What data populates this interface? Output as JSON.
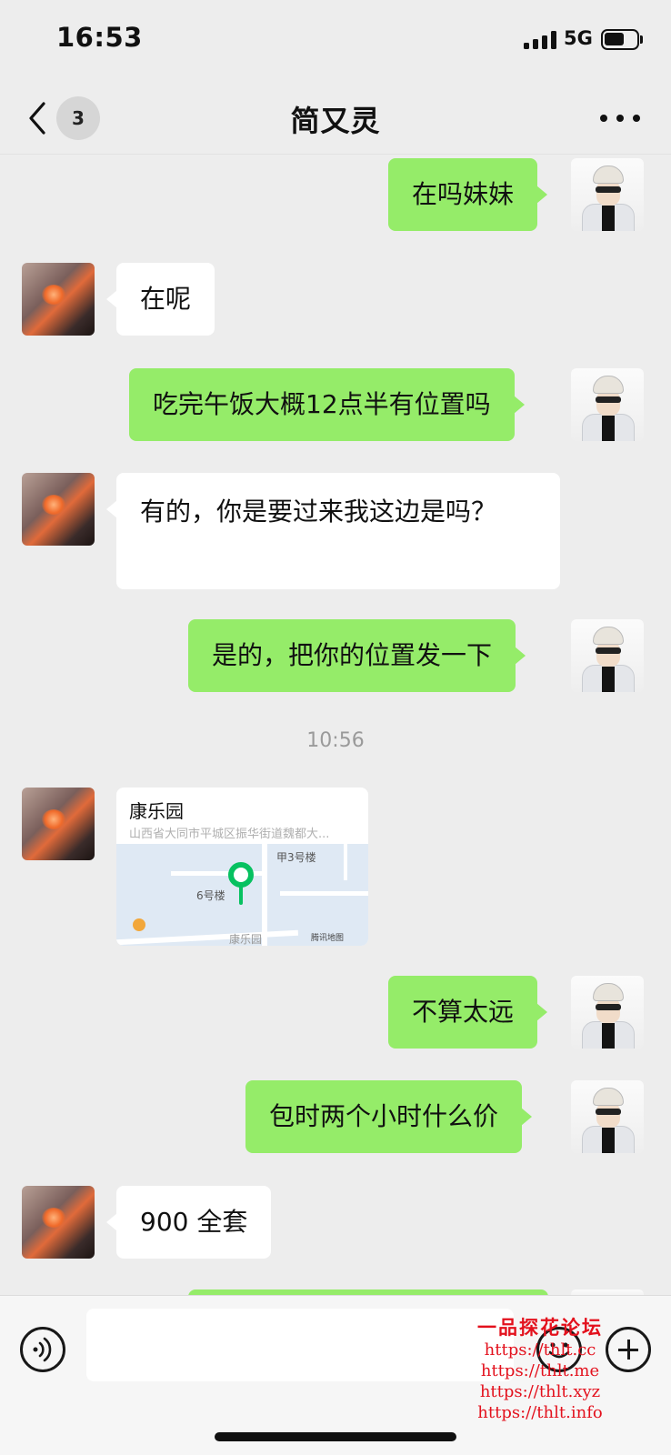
{
  "status_bar": {
    "time": "16:53",
    "network": "5G"
  },
  "header": {
    "unread_count": "3",
    "title": "简又灵"
  },
  "messages": [
    {
      "sender": "me",
      "text": "在吗妹妹"
    },
    {
      "sender": "her",
      "text": "在呢"
    },
    {
      "sender": "me",
      "text": "吃完午饭大概12点半有位置吗"
    },
    {
      "sender": "her",
      "text": "有的，你是要过来我这边是吗？"
    },
    {
      "sender": "me",
      "text": "是的，把你的位置发一下"
    },
    {
      "timestamp": "10:56"
    },
    {
      "sender": "her",
      "type": "location",
      "title": "康乐园",
      "address": "山西省大同市平城区振华街道魏都大...",
      "map_labels": [
        "甲3号楼",
        "6号楼",
        "康乐园"
      ],
      "map_provider": "腾讯地图"
    },
    {
      "sender": "me",
      "text": "不算太远"
    },
    {
      "sender": "me",
      "text": "包时两个小时什么价"
    },
    {
      "sender": "her",
      "text": "900 全套"
    }
  ],
  "input": {
    "placeholder": ""
  },
  "watermark": {
    "title": "一品探花论坛",
    "links": [
      "https://thlt.cc",
      "https://thlt.me",
      "https://thlt.xyz",
      "https://thlt.info"
    ]
  },
  "colors": {
    "my_bubble": "#95ec69",
    "her_bubble": "#ffffff",
    "background": "#ededed",
    "pin": "#07c160",
    "watermark": "#e3111d"
  }
}
